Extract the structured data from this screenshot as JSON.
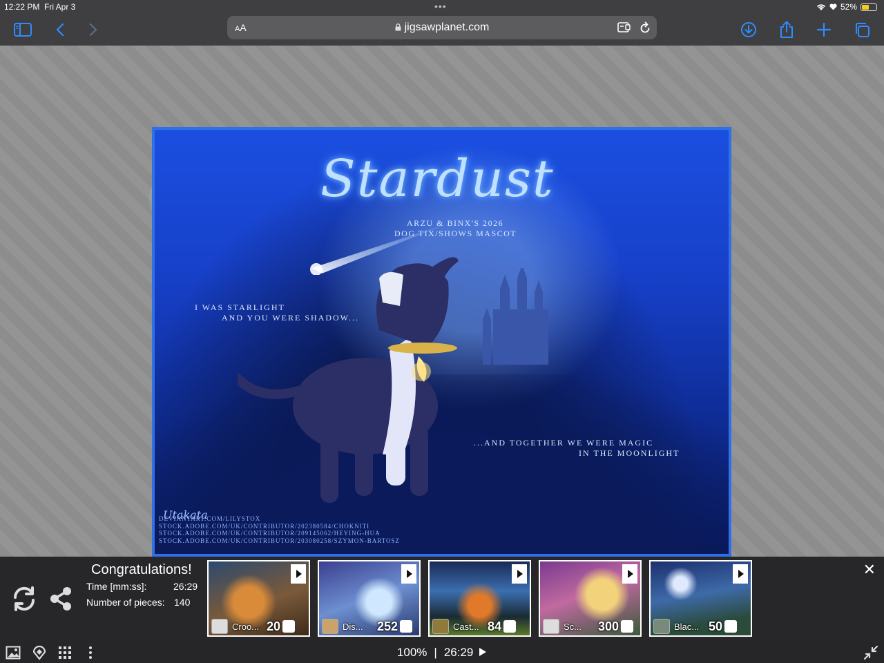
{
  "status_bar": {
    "time": "12:22 PM",
    "date": "Fri Apr 3",
    "battery": "52%",
    "battery_level": 0.52
  },
  "browser": {
    "text_size_label_small": "A",
    "text_size_label_large": "A",
    "url": "jigsawplanet.com",
    "accent_color": "#2f8cff"
  },
  "puzzle_image": {
    "title": "Stardust",
    "subtitle_line1": "Arzu & Binx's 2026",
    "subtitle_line2": "Dog Tix/Shows Mascot",
    "quote_line1": "I was starlight",
    "quote_line2": "and you were shadow...",
    "quote_line3": "...and together we were magic",
    "quote_line4": "in the moonlight",
    "signature": "Utakata",
    "credits": [
      "deviantart.com/lilystox",
      "stock.adobe.com/uk/contributor/202380584/chokniti",
      "stock.adobe.com/uk/contributor/209145062/heying-hua",
      "stock.adobe.com/uk/contributor/203080258/szymon-bartosz"
    ]
  },
  "congrats": {
    "title": "Congratulations!",
    "time_label": "Time [mm:ss]:",
    "time_value": "26:29",
    "pieces_label": "Number of pieces:",
    "pieces_value": "140"
  },
  "suggestions": [
    {
      "name": "Croo...",
      "count": "20"
    },
    {
      "name": "Dis...",
      "count": "252"
    },
    {
      "name": "Cast...",
      "count": "84"
    },
    {
      "name": "Sc...",
      "count": "300"
    },
    {
      "name": "Blac...",
      "count": "50"
    }
  ],
  "bottom_bar": {
    "zoom": "100%",
    "separator": "|",
    "timer": "26:29"
  }
}
